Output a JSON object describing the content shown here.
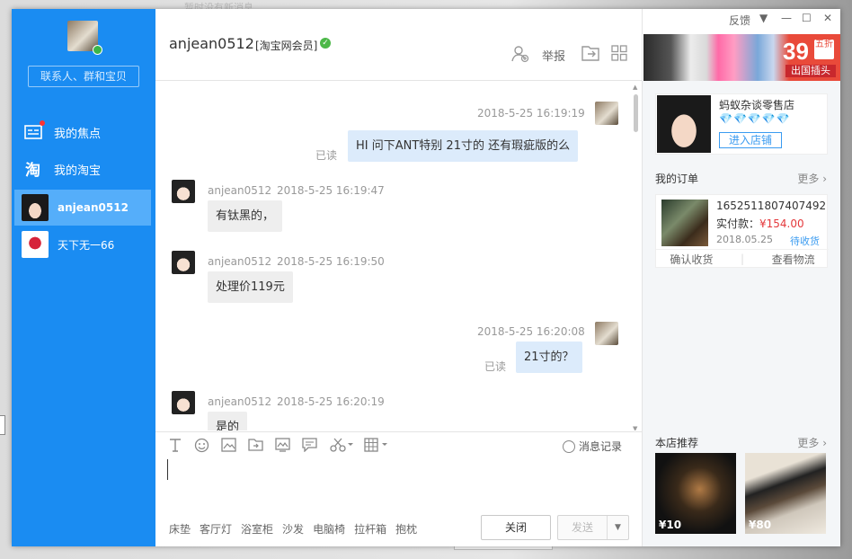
{
  "background": {
    "top_peek": "暂时没有新消息"
  },
  "sidebar": {
    "search_placeholder": "联系人、群和宝贝",
    "nav": [
      {
        "label": "我的焦点",
        "icon": "focus-icon"
      },
      {
        "label": "我的淘宝",
        "icon": "taobao-icon"
      }
    ],
    "contacts": [
      {
        "label": "anjean0512",
        "active": true
      },
      {
        "label": "天下无一66",
        "active": false
      }
    ]
  },
  "chat": {
    "title": "anjean0512",
    "member_badge": "[淘宝网会员]",
    "report_label": "举报",
    "messages": [
      {
        "direction": "out",
        "time": "2018-5-25 16:19:19",
        "text": "HI 问下ANT特别 21寸的 还有瑕疵版的么",
        "read": "已读"
      },
      {
        "direction": "in",
        "sender": "anjean0512",
        "time": "2018-5-25 16:19:47",
        "text": "有钛黑的，"
      },
      {
        "direction": "in",
        "sender": "anjean0512",
        "time": "2018-5-25 16:19:50",
        "text": "处理价119元"
      },
      {
        "direction": "out",
        "time": "2018-5-25 16:20:08",
        "text": "21寸的？",
        "read": "已读"
      },
      {
        "direction": "in",
        "sender": "anjean0512",
        "time": "2018-5-25 16:20:19",
        "text": "是的"
      }
    ],
    "history_label": "消息记录",
    "quick_words": [
      "床垫",
      "客厅灯",
      "浴室柜",
      "沙发",
      "电脑椅",
      "拉杆箱",
      "抱枕"
    ],
    "close_label": "关闭",
    "send_label": "发送"
  },
  "window": {
    "feedback_label": "反馈"
  },
  "ad": {
    "number": "39",
    "sale": "五折",
    "subtitle": "出国插头"
  },
  "shop": {
    "name": "蚂蚁杂谈零售店",
    "diamonds": "💎💎💎💎💎",
    "enter_label": "进入店铺"
  },
  "orders": {
    "title": "我的订单",
    "more": "更多",
    "order_no": "1652511807407492",
    "pay_label": "实付款：",
    "amount": "¥154.00",
    "date": "2018.05.25",
    "status": "待收货",
    "confirm_label": "确认收货",
    "logistics_label": "查看物流"
  },
  "recommend": {
    "title": "本店推荐",
    "more": "更多",
    "items": [
      {
        "price": "¥10"
      },
      {
        "price": "¥80"
      }
    ]
  }
}
